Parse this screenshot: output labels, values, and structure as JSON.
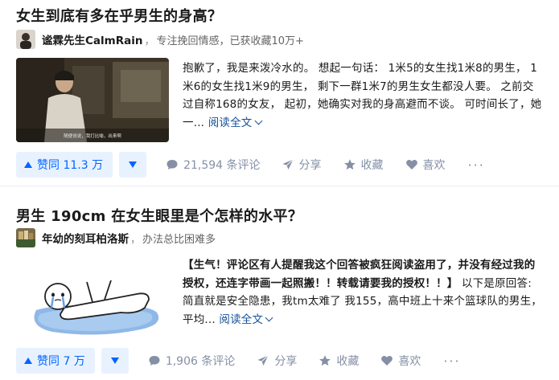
{
  "items": [
    {
      "question": "女生到底有多在乎男生的身高？",
      "author": {
        "name": "谧霖先生CalmRain",
        "bio": "专注挽回情感，已获收藏10万+"
      },
      "thumbnail": {
        "caption": "随便说说，我打比喻，出来啊"
      },
      "excerpt": {
        "text": "抱歉了，我是来泼冷水的。 想起一句话： 1米5的女生找1米8的男生， 1米6的女生找1米9的男生， 剩下一群1米7的男生女生都没人要。 之前交过自称168的女友， 起初，她确实对我的身高避而不谈。 可时间长了，她一...",
        "read_more": "阅读全文"
      },
      "actions": {
        "upvote": "赞同 11.3 万",
        "comments": "21,594 条评论",
        "share": "分享",
        "collect": "收藏",
        "like": "喜欢",
        "more": "···"
      }
    },
    {
      "question": "男生 190cm 在女生眼里是个怎样的水平？",
      "author": {
        "name": "年幼的刻耳柏洛斯",
        "bio": "办法总比困难多"
      },
      "excerpt": {
        "bold": "【生气！评论区有人提醒我这个回答被疯狂阅读盗用了，并没有经过我的授权，还连字带画一起照搬！！转载请要我的授权！！】",
        "text": " 以下是原回答: 简直就是安全隐患，我tm太难了 我155，高中班上十来个篮球队的男生，平均...",
        "read_more": "阅读全文"
      },
      "actions": {
        "upvote": "赞同 7 万",
        "comments": "1,906 条评论",
        "share": "分享",
        "collect": "收藏",
        "like": "喜欢",
        "more": "···"
      }
    }
  ],
  "colors": {
    "accent": "#0066ff",
    "accent_bg": "#e8f2ff",
    "link": "#175199",
    "meta": "#8590a6"
  },
  "icons": {
    "comment": "comment-icon",
    "share": "share-icon",
    "collect": "star-icon",
    "like": "heart-icon"
  }
}
